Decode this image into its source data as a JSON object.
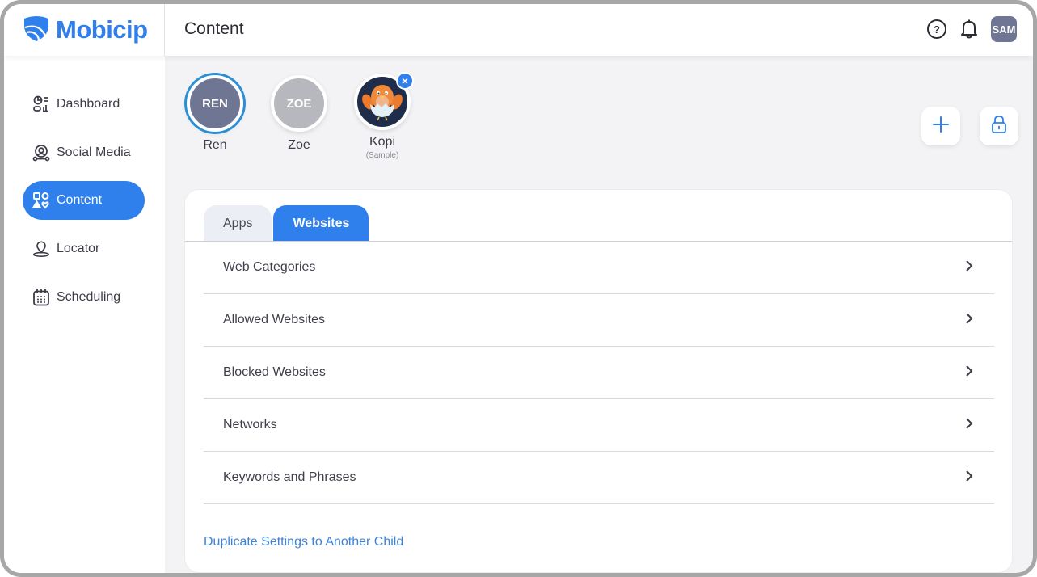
{
  "app": {
    "brand": "Mobicip",
    "brand_color": "#2f80ed",
    "page_title": "Content"
  },
  "header": {
    "icons": [
      "help-icon",
      "bell-icon"
    ],
    "user_avatar_initials": "SAM"
  },
  "sidebar": {
    "items": [
      {
        "label": "Dashboard",
        "icon": "dashboard-icon",
        "active": false
      },
      {
        "label": "Social Media",
        "icon": "social-media-icon",
        "active": false
      },
      {
        "label": "Content",
        "icon": "content-icon",
        "active": true
      },
      {
        "label": "Locator",
        "icon": "locator-icon",
        "active": false
      },
      {
        "label": "Scheduling",
        "icon": "calendar-icon",
        "active": false
      }
    ]
  },
  "children": [
    {
      "initials": "REN",
      "name": "Ren",
      "selected": true,
      "color": "#6f7694"
    },
    {
      "initials": "ZOE",
      "name": "Zoe",
      "selected": false,
      "color": "#b7b8bd"
    },
    {
      "initials": "",
      "name": "Kopi",
      "subtitle": "(Sample)",
      "selected": false,
      "avatar": "bird-icon",
      "removable": true,
      "remove_glyph": "×"
    }
  ],
  "actions": {
    "add_icon": "plus-icon",
    "lock_icon": "lock-icon"
  },
  "tabs": [
    {
      "label": "Apps",
      "active": false
    },
    {
      "label": "Websites",
      "active": true
    }
  ],
  "website_settings": [
    {
      "label": "Web Categories"
    },
    {
      "label": "Allowed Websites"
    },
    {
      "label": "Blocked Websites"
    },
    {
      "label": "Networks"
    },
    {
      "label": "Keywords and Phrases"
    }
  ],
  "duplicate_link": "Duplicate Settings to Another Child"
}
